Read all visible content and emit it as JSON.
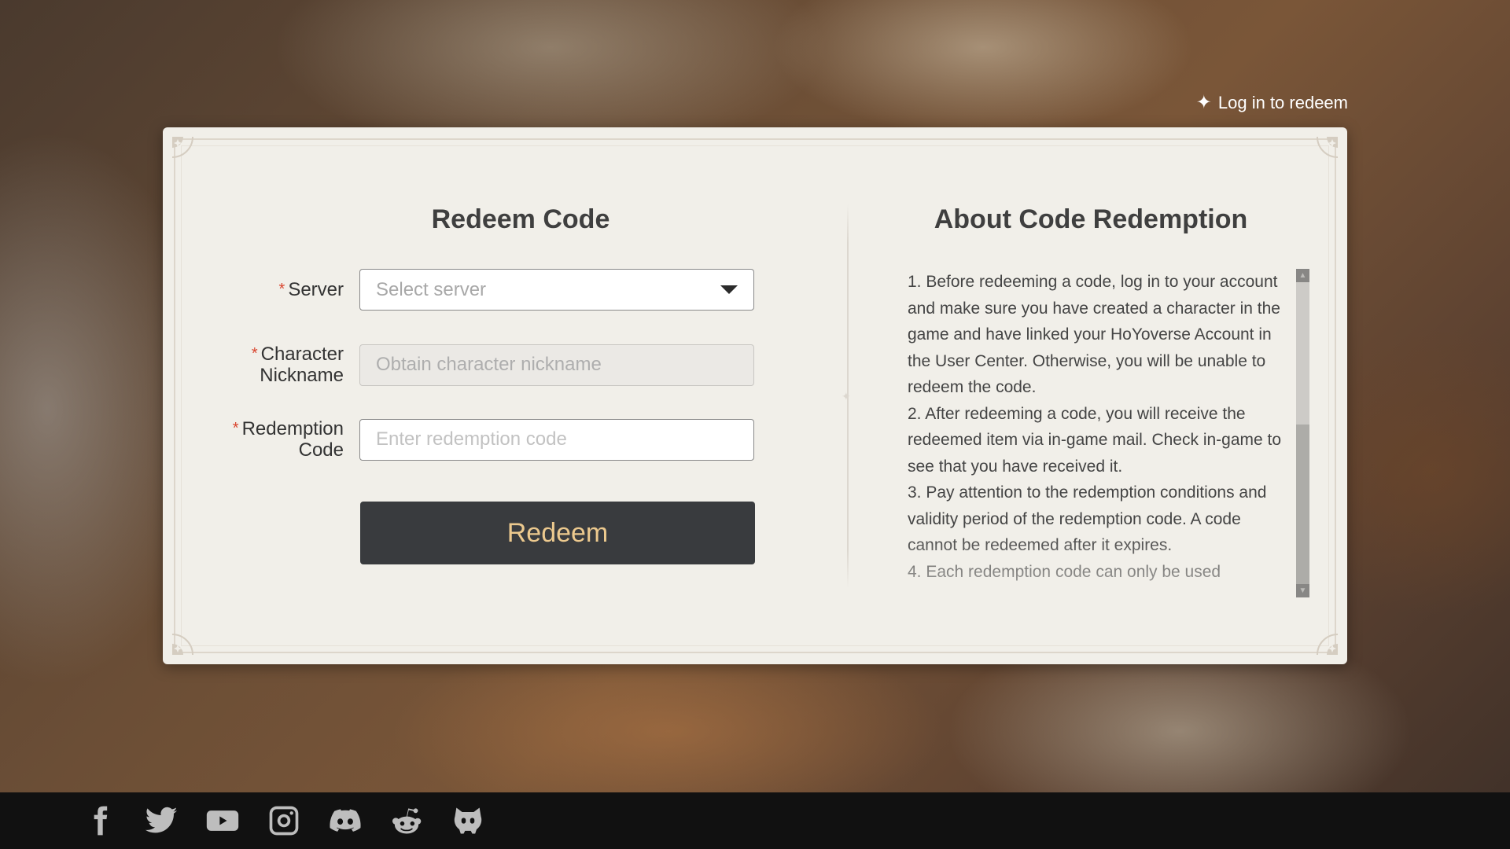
{
  "header": {
    "login_icon": "sparkle-icon",
    "login_label": "Log in to redeem"
  },
  "redeem_form": {
    "title": "Redeem Code",
    "required_mark": "*",
    "server": {
      "label": "Server",
      "placeholder": "Select server",
      "value": ""
    },
    "nickname": {
      "label_line1": "Character",
      "label_line2": "Nickname",
      "placeholder": "Obtain character nickname",
      "value": ""
    },
    "code": {
      "label_line1": "Redemption",
      "label_line2": "Code",
      "placeholder": "Enter redemption code",
      "value": ""
    },
    "submit_label": "Redeem"
  },
  "about": {
    "title": "About Code Redemption",
    "notes": [
      "1. Before redeeming a code, log in to your account and make sure you have created a character in the game and have linked your HoYoverse Account in the User Center. Otherwise, you will be unable to redeem the code.",
      "2. After redeeming a code, you will receive the redeemed item via in-game mail. Check in-game to see that you have received it.",
      "3. Pay attention to the redemption conditions and validity period of the redemption code. A code cannot be redeemed after it expires.",
      "4. Each redemption code can only be used"
    ]
  },
  "footer": {
    "social": [
      {
        "name": "facebook",
        "icon": "facebook-icon"
      },
      {
        "name": "twitter",
        "icon": "twitter-icon"
      },
      {
        "name": "youtube",
        "icon": "youtube-icon"
      },
      {
        "name": "instagram",
        "icon": "instagram-icon"
      },
      {
        "name": "discord",
        "icon": "discord-icon"
      },
      {
        "name": "reddit",
        "icon": "reddit-icon"
      },
      {
        "name": "hoyolab",
        "icon": "hoyolab-icon"
      }
    ]
  },
  "colors": {
    "button_bg": "#393b3e",
    "button_text": "#ecc98e",
    "required": "#d9452e",
    "card_bg": "#f1efe9"
  }
}
